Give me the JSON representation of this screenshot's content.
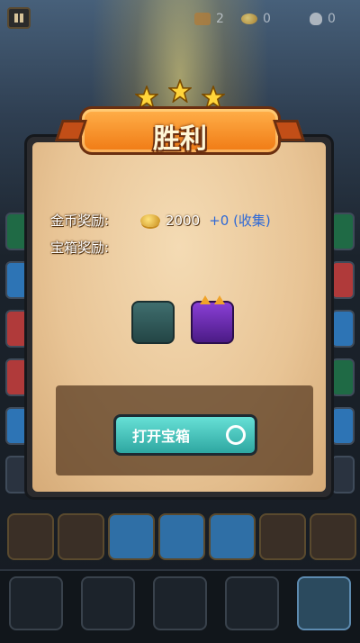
{
  "top": {
    "boxes": "2",
    "coins": "0",
    "skulls": "0"
  },
  "modal": {
    "title": "胜利",
    "stars": 3,
    "coin_reward_label": "金币奖励:",
    "coin_amount": "2000",
    "coin_bonus": "+0 (收集)",
    "chest_reward_label": "宝箱奖励:",
    "open_button_label": "打开宝箱"
  }
}
